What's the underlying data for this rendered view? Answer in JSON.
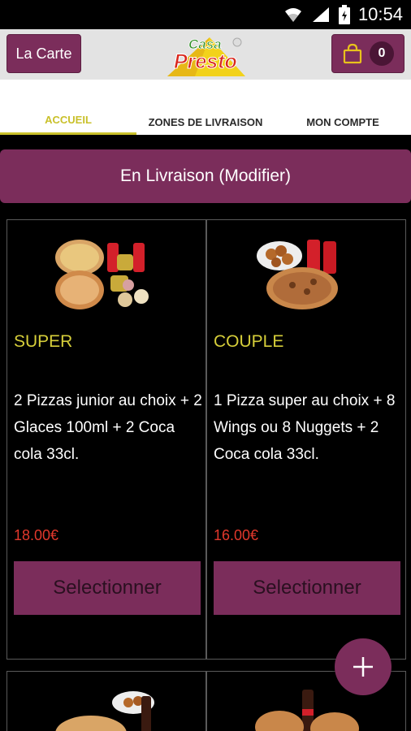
{
  "status": {
    "time": "10:54"
  },
  "header": {
    "menu_button": "La Carte",
    "logo_line1": "Casa",
    "logo_line2": "Presto",
    "cart_count": "0"
  },
  "tabs": [
    {
      "label": "ACCUEIL",
      "active": true
    },
    {
      "label": "ZONES DE LIVRAISON",
      "active": false
    },
    {
      "label": "MON COMPTE",
      "active": false
    }
  ],
  "delivery_button": "En Livraison (Modifier)",
  "products": [
    {
      "title": "SUPER",
      "description": "2 Pizzas junior au choix + 2 Glaces 100ml  + 2 Coca cola 33cl.",
      "price": "18.00€",
      "button": "Selectionner"
    },
    {
      "title": "COUPLE",
      "description": "1 Pizza super au choix + 8 Wings ou 8 Nuggets + 2 Coca cola 33cl.",
      "price": "16.00€",
      "button": "Selectionner"
    }
  ],
  "colors": {
    "primary": "#7b2d5b",
    "title_yellow": "#d6ce3a",
    "price_red": "#e2382c",
    "tab_active": "#c9c02a"
  }
}
